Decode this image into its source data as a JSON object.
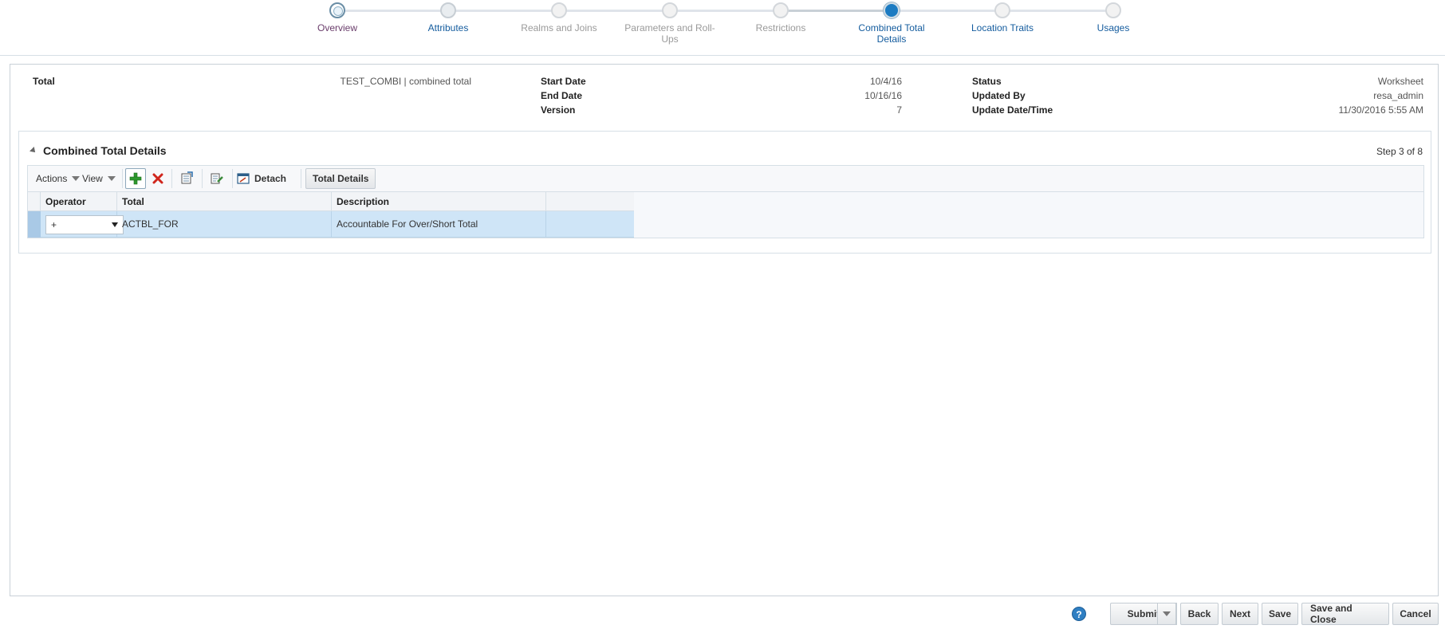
{
  "train": {
    "stops": [
      {
        "label": "Overview"
      },
      {
        "label": "Attributes"
      },
      {
        "label": "Realms and Joins"
      },
      {
        "label": "Parameters and Roll-Ups"
      },
      {
        "label": "Restrictions"
      },
      {
        "label": "Combined Total Details"
      },
      {
        "label": "Location Traits"
      },
      {
        "label": "Usages"
      }
    ],
    "current": "Combined Total Details"
  },
  "header": {
    "total_label": "Total",
    "total_value": "TEST_COMBI | combined total",
    "start_date_label": "Start Date",
    "start_date_value": "10/4/16",
    "end_date_label": "End Date",
    "end_date_value": "10/16/16",
    "version_label": "Version",
    "version_value": "7",
    "status_label": "Status",
    "status_value": "Worksheet",
    "updated_by_label": "Updated By",
    "updated_by_value": "resa_admin",
    "update_datetime_label": "Update Date/Time",
    "update_datetime_value": "11/30/2016 5:55 AM"
  },
  "section": {
    "title": "Combined Total Details",
    "step": "Step 3 of 8"
  },
  "toolbar": {
    "actions_label": "Actions",
    "view_label": "View",
    "detach_label": "Detach",
    "total_details_label": "Total Details"
  },
  "table": {
    "columns": [
      "Operator",
      "Total",
      "Description"
    ],
    "rows": [
      {
        "operator": "+",
        "total": "ACTBL_FOR",
        "description": "Accountable For Over/Short Total"
      }
    ]
  },
  "footer": {
    "help_glyph": "?",
    "submit_label": "Submit",
    "back_label": "Back",
    "next_label": "Next",
    "save_label": "Save",
    "save_close_label": "Save and Close",
    "cancel_label": "Cancel"
  },
  "colors": {
    "accent": "#1b7bc2",
    "link": "#145c9e",
    "selected_row": "#cfe5f7"
  }
}
